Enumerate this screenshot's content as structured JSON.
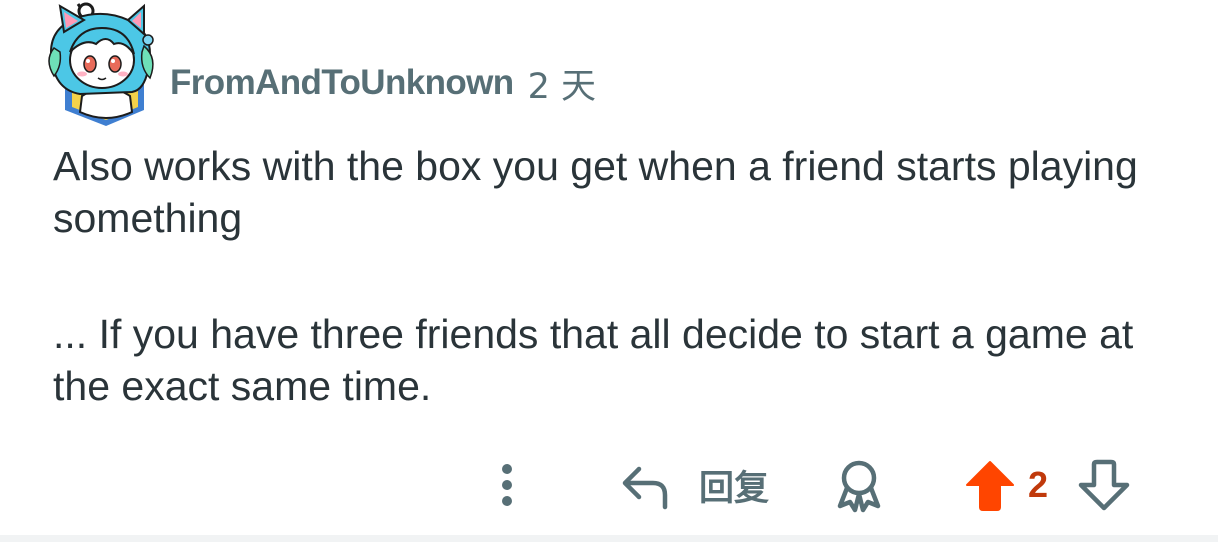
{
  "comment": {
    "author": "FromAndToUnknown",
    "timestamp": "2 天",
    "body": [
      "Also works with the box you get when a friend starts playing something",
      "... If you have three friends that all decide to start a game at the exact same time."
    ],
    "score": "2"
  },
  "actions": {
    "more_icon": "more-vertical-icon",
    "reply_icon": "reply-arrow-icon",
    "reply_label": "回复",
    "award_icon": "award-icon",
    "upvote_icon": "upvote-arrow-filled-icon",
    "downvote_icon": "downvote-arrow-outline-icon"
  },
  "colors": {
    "text": "#2a3439",
    "meta": "#576f76",
    "upvote": "#ff4500",
    "score": "#c0390b"
  }
}
